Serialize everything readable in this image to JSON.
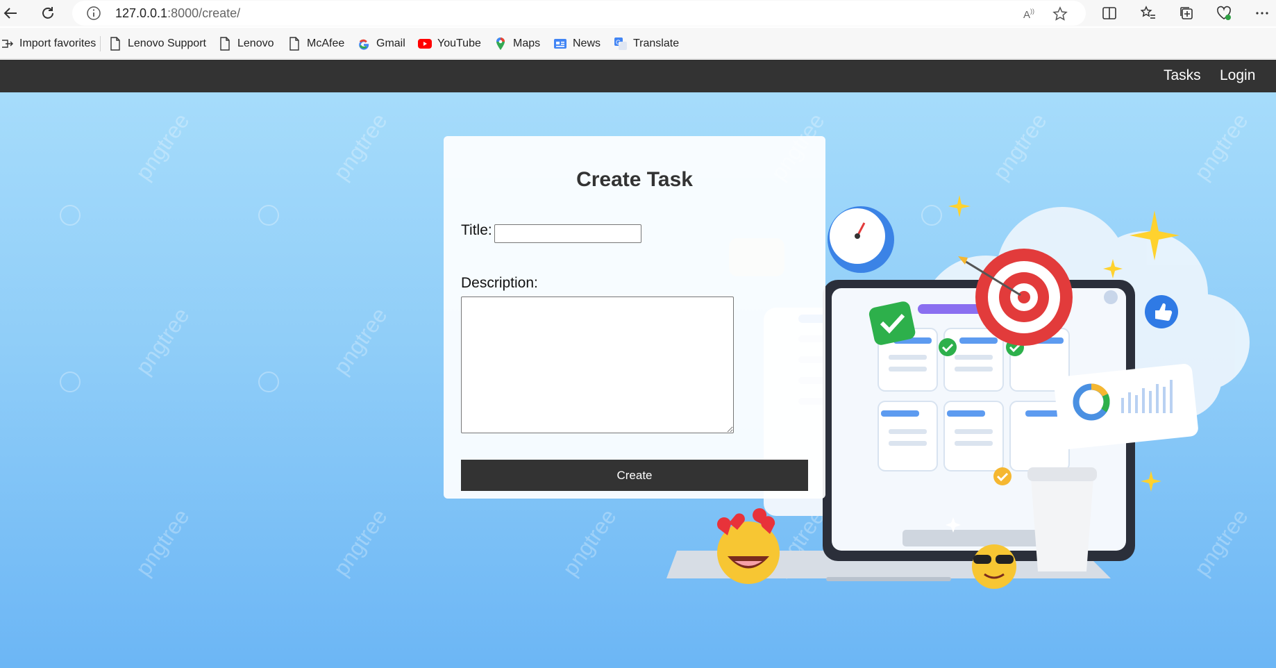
{
  "browser": {
    "url_host": "127.0.0.1",
    "url_rest": ":8000/create/",
    "bookmarks": [
      {
        "label": "Import favorites",
        "icon": "import-icon"
      },
      {
        "label": "Lenovo Support",
        "icon": "page-icon"
      },
      {
        "label": "Lenovo",
        "icon": "page-icon"
      },
      {
        "label": "McAfee",
        "icon": "page-icon"
      },
      {
        "label": "Gmail",
        "icon": "google-icon"
      },
      {
        "label": "YouTube",
        "icon": "youtube-icon"
      },
      {
        "label": "Maps",
        "icon": "maps-icon"
      },
      {
        "label": "News",
        "icon": "news-icon"
      },
      {
        "label": "Translate",
        "icon": "translate-icon"
      }
    ]
  },
  "nav": {
    "links": [
      "Tasks",
      "Login"
    ],
    "background": "#333333"
  },
  "form": {
    "heading": "Create Task",
    "title_label": "Title:",
    "title_value": "",
    "description_label": "Description:",
    "description_value": "",
    "submit_label": "Create"
  },
  "watermark": {
    "text": "pngtree"
  },
  "colors": {
    "page_top": "#a6dcfb",
    "page_bottom": "#6cb6f5",
    "button": "#333333"
  }
}
